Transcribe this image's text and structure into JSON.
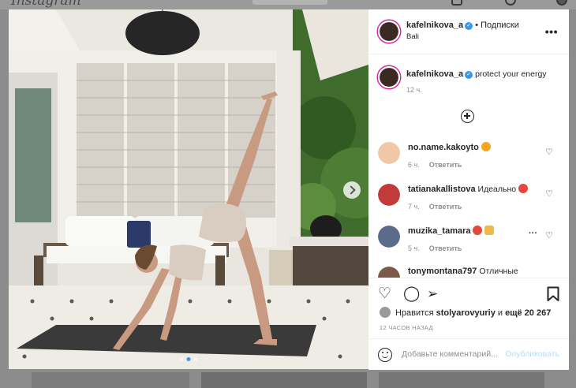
{
  "background": {
    "logo": "Instagram"
  },
  "post": {
    "carousel": {
      "count": 3,
      "active_index": 1
    },
    "author": {
      "username": "kafelnikova_a",
      "verified": true,
      "follow_label": "• Подписки",
      "location": "Bali"
    },
    "caption": {
      "username": "kafelnikova_a",
      "text": "protect your energy",
      "time": "12 ч."
    },
    "comments": [
      {
        "username": "no.name.kakoyto",
        "text": "",
        "emoji_color": "#f5a623",
        "time": "6 ч.",
        "reply": "Ответить",
        "avatar_color": "#f0c8a8"
      },
      {
        "username": "tatianakallistova",
        "text": "Идеально",
        "emoji_color": "#e2483d",
        "time": "7 ч.",
        "reply": "Ответить",
        "avatar_color": "#c23b3b"
      },
      {
        "username": "muzika_tamara",
        "text": "",
        "emoji_color": "#e2483d",
        "time": "5 ч.",
        "reply": "Ответить",
        "avatar_color": "#5b6b8a"
      },
      {
        "username": "tonymontana797",
        "text": "Отличные",
        "emoji_color": "",
        "time": "",
        "reply": "",
        "avatar_color": "#7a5a4a"
      }
    ],
    "likes": {
      "prefix": "Нравится",
      "user": "stolyarovyuriy",
      "middle": "и",
      "more": "ещё 20 267"
    },
    "posted_ago": "12 ЧАСОВ НАЗАД",
    "comment_input": {
      "placeholder": "Добавьте комментарий...",
      "submit_label": "Опубликовать"
    },
    "colors": {
      "accent": "#3897f0",
      "submit_disabled": "#b2dffc",
      "story_ring": "#d6249f"
    }
  }
}
